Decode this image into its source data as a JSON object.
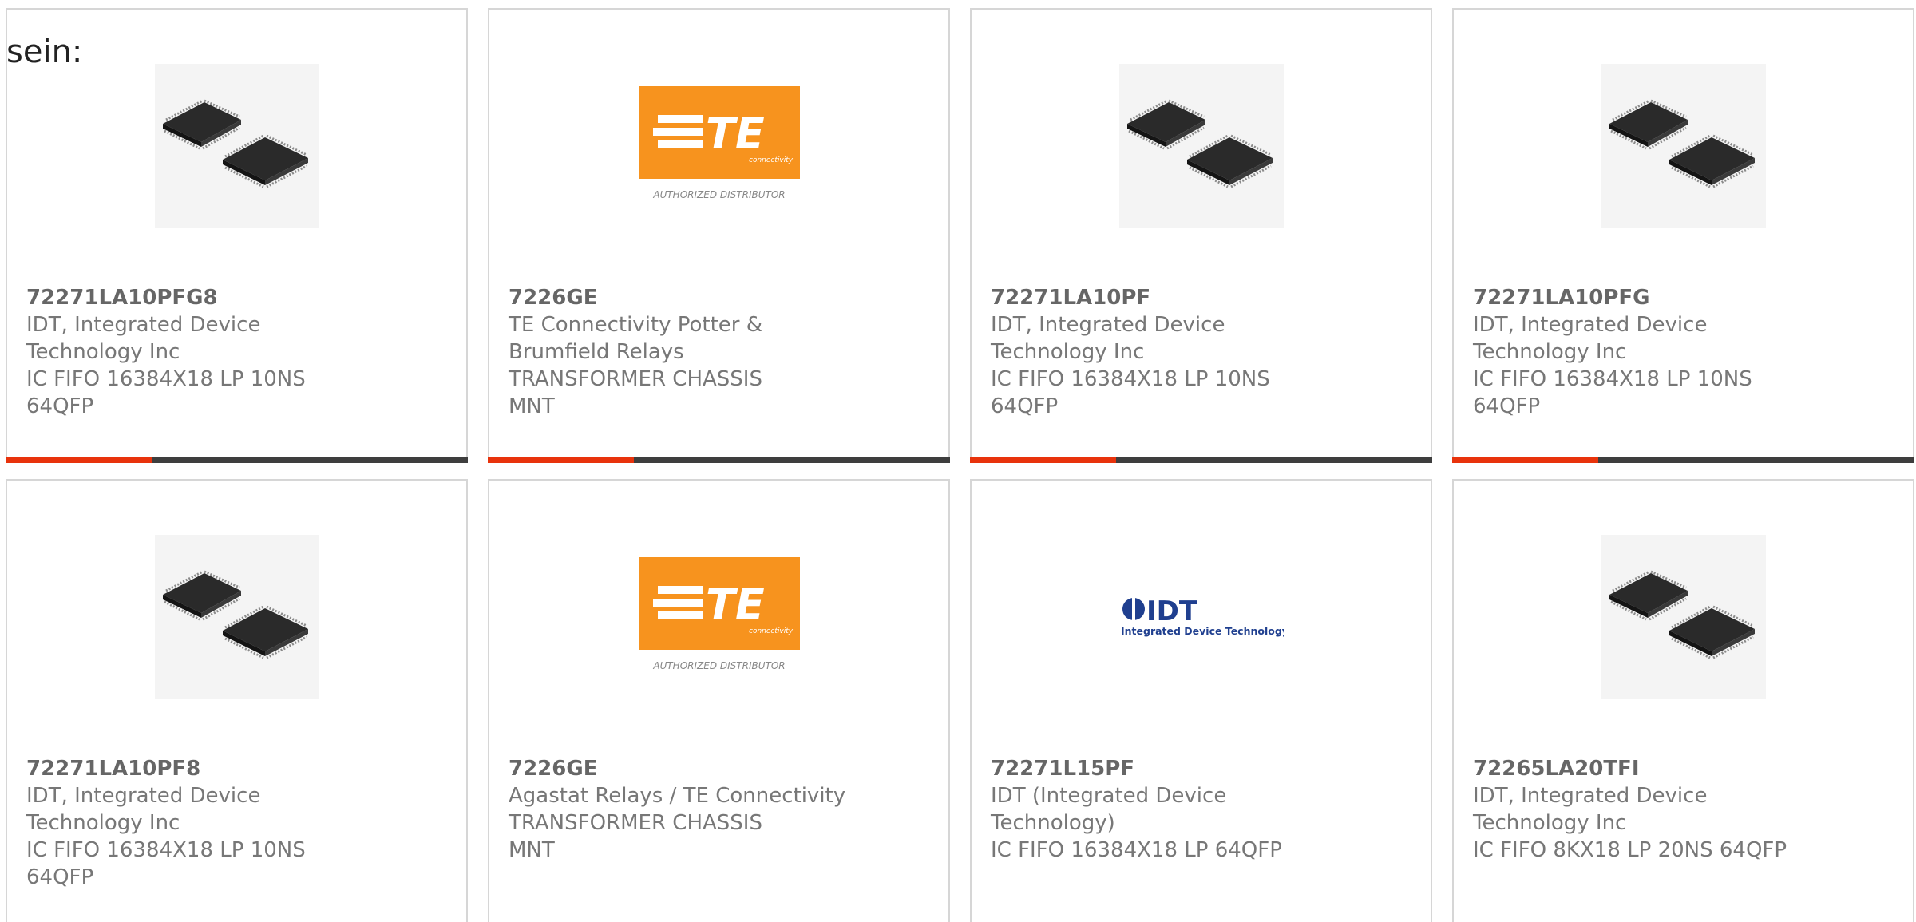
{
  "intro_text": "sein:",
  "products": [
    {
      "part": "72271LA10PFG8",
      "manufacturer": "IDT, Integrated Device Technology Inc",
      "description": "IC FIFO 16384X18 LP 10NS 64QFP",
      "image": "chip-package-icon"
    },
    {
      "part": "7226GE",
      "manufacturer": "TE Connectivity Potter & Brumfield Relays",
      "description": "TRANSFORMER CHASSIS MNT",
      "image": "te-connectivity-logo"
    },
    {
      "part": "72271LA10PF",
      "manufacturer": "IDT, Integrated Device Technology Inc",
      "description": "IC FIFO 16384X18 LP 10NS 64QFP",
      "image": "chip-package-icon"
    },
    {
      "part": "72271LA10PFG",
      "manufacturer": "IDT, Integrated Device Technology Inc",
      "description": "IC FIFO 16384X18 LP 10NS 64QFP",
      "image": "chip-package-icon"
    },
    {
      "part": "72271LA10PF8",
      "manufacturer": "IDT, Integrated Device Technology Inc",
      "description": "IC FIFO 16384X18 LP 10NS 64QFP",
      "image": "chip-package-icon"
    },
    {
      "part": "7226GE",
      "manufacturer": "Agastat Relays / TE Connectivity",
      "description": "TRANSFORMER CHASSIS MNT",
      "image": "te-connectivity-logo"
    },
    {
      "part": "72271L15PF",
      "manufacturer": "IDT (Integrated Device Technology)",
      "description": "IC FIFO 16384X18 LP 64QFP",
      "image": "idt-logo"
    },
    {
      "part": "72265LA20TFI",
      "manufacturer": "IDT, Integrated Device Technology Inc",
      "description": "IC FIFO 8KX18 LP 20NS 64QFP",
      "image": "chip-package-icon"
    }
  ],
  "te_logo": {
    "wordmark": "TE",
    "tagline": "connectivity",
    "caption": "AUTHORIZED DISTRIBUTOR"
  },
  "idt_logo": {
    "wordmark": "IDT",
    "tagline": "Integrated Device Technology"
  },
  "colors": {
    "accent": "#e8330c",
    "bar": "#3e3e3e",
    "te_orange": "#f7931e",
    "idt_blue": "#1f3f8f"
  }
}
